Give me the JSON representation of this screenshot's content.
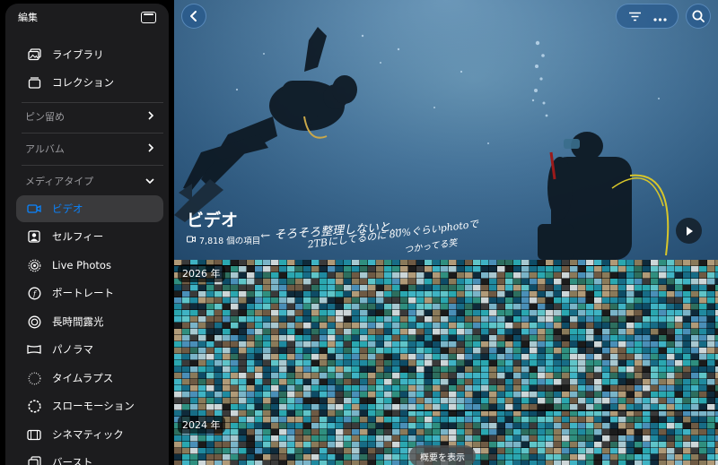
{
  "sidebar": {
    "edit_label": "編集",
    "top_items": [
      {
        "label": "ライブラリ",
        "icon": "photo-library-icon"
      },
      {
        "label": "コレクション",
        "icon": "collections-icon"
      }
    ],
    "sections": [
      {
        "label": "ピン留め",
        "expanded": false
      },
      {
        "label": "アルバム",
        "expanded": false
      },
      {
        "label": "メディアタイプ",
        "expanded": true
      }
    ],
    "media_types": [
      {
        "label": "ビデオ",
        "icon": "video-icon",
        "selected": true
      },
      {
        "label": "セルフィー",
        "icon": "selfie-icon",
        "selected": false
      },
      {
        "label": "Live Photos",
        "icon": "live-photos-icon",
        "selected": false
      },
      {
        "label": "ポートレート",
        "icon": "portrait-icon",
        "selected": false
      },
      {
        "label": "長時間露光",
        "icon": "long-exposure-icon",
        "selected": false
      },
      {
        "label": "パノラマ",
        "icon": "panorama-icon",
        "selected": false
      },
      {
        "label": "タイムラプス",
        "icon": "timelapse-icon",
        "selected": false
      },
      {
        "label": "スローモーション",
        "icon": "slow-motion-icon",
        "selected": false
      },
      {
        "label": "シネマティック",
        "icon": "cinematic-icon",
        "selected": false
      },
      {
        "label": "バースト",
        "icon": "burst-icon",
        "selected": false
      }
    ],
    "accent_color": "#0a84ff"
  },
  "header": {
    "title": "ビデオ",
    "item_count": "7,818 個の項目"
  },
  "annotation": {
    "line1": "← そろそろ整理しないと…",
    "line2": "2TBにしてるのに 80%ぐらいphotoで",
    "line3": "つかってる笑"
  },
  "grid": {
    "year_labels": [
      "2026 年",
      "2024 年"
    ]
  },
  "footer": {
    "summary_button": "概要を表示"
  }
}
